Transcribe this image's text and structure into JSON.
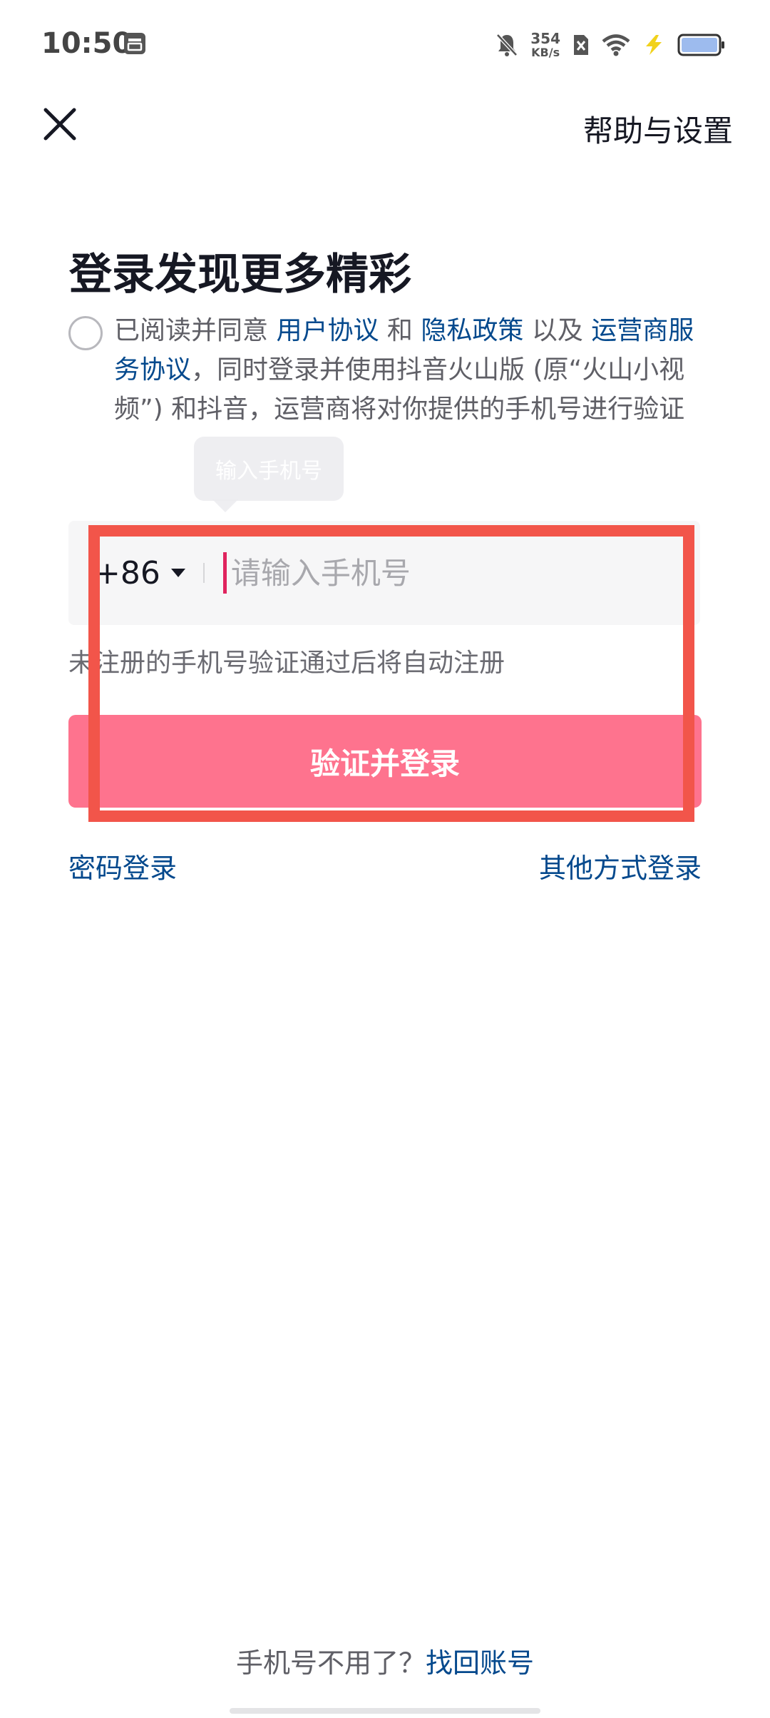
{
  "status_bar": {
    "time": "10:50",
    "net_speed_value": "354",
    "net_speed_unit": "KB/s",
    "icons": [
      "storage-icon",
      "bell-muted-icon",
      "sim-x-icon",
      "wifi-icon",
      "charging-bolt-icon",
      "battery-icon"
    ],
    "battery_color": "#9dbbee"
  },
  "header": {
    "close_icon": "close-icon",
    "help_label": "帮助与设置"
  },
  "title": "登录发现更多精彩",
  "agreement": {
    "prefix": "已阅读并同意 ",
    "user_agreement": "用户协议",
    "and1": " 和 ",
    "privacy_policy": "隐私政策",
    "and2": " 以及 ",
    "carrier_agreement": "运营商服务协议",
    "suffix": "，同时登录并使用抖音火山版 (原“火山小视频”) 和抖音，运营商将对你提供的手机号进行验证"
  },
  "tooltip": "输入手机号",
  "phone_input": {
    "country_code": "+86",
    "placeholder": "请输入手机号",
    "value": ""
  },
  "register_hint": "未注册的手机号验证通过后将自动注册",
  "login_button": "验证并登录",
  "alt_login": {
    "password": "密码登录",
    "other": "其他方式登录"
  },
  "bottom": {
    "question": "手机号不用了？",
    "recover": "找回账号"
  },
  "colors": {
    "accent": "#fe738e",
    "link": "#04498d",
    "highlight": "#f2554a",
    "cursor": "#e0245e"
  }
}
